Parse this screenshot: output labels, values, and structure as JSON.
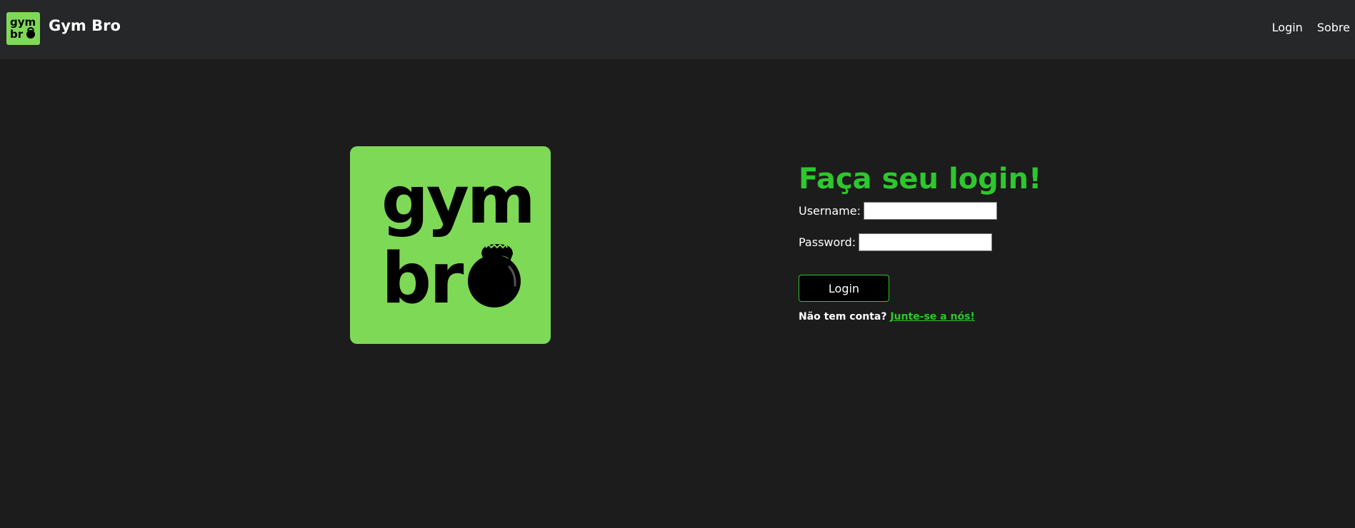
{
  "navbar": {
    "logo_text_top": "gym",
    "logo_text_bottom": "br",
    "brand": "Gym Bro",
    "links": [
      {
        "label": "Login"
      },
      {
        "label": "Sobre"
      }
    ]
  },
  "hero_logo": {
    "text_top": "gym",
    "text_bottom": "br",
    "icon": "kettlebell-icon"
  },
  "login_form": {
    "title": "Faça seu login!",
    "username_label": "Username:",
    "username_value": "",
    "password_label": "Password:",
    "password_value": "",
    "submit_label": "Login",
    "signup_prompt": "Não tem conta?",
    "signup_link": "Junte-se a nós!"
  },
  "colors": {
    "accent_green": "#2ec72e",
    "logo_green": "#7ed957",
    "background": "#1c1c1c",
    "navbar": "#262729"
  }
}
